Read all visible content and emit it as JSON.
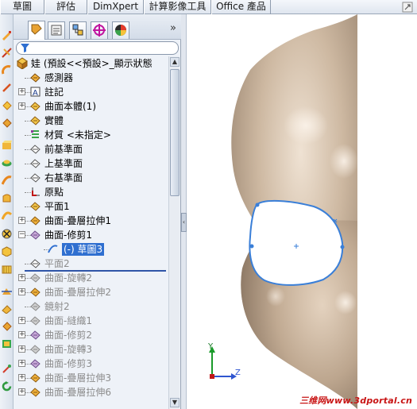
{
  "toptabs": [
    "草圖",
    "評估",
    "DimXpert",
    "計算影像工具",
    "Office 產品"
  ],
  "tree": {
    "root_label": "娃 (預設<<預設>_顯示狀態",
    "items": [
      {
        "label": "感測器",
        "icon": "sensor-icon",
        "expander": false,
        "grey": false
      },
      {
        "label": "註記",
        "icon": "annotation-icon",
        "expander": true,
        "grey": false
      },
      {
        "label": "曲面本體(1)",
        "icon": "surface-bodies-icon",
        "expander": true,
        "grey": false
      },
      {
        "label": "實體",
        "icon": "solid-bodies-icon",
        "expander": false,
        "grey": false
      },
      {
        "label": "材質 <未指定>",
        "icon": "material-icon",
        "expander": false,
        "grey": false
      },
      {
        "label": "前基準面",
        "icon": "plane-icon",
        "expander": false,
        "grey": false
      },
      {
        "label": "上基準面",
        "icon": "plane-icon",
        "expander": false,
        "grey": false
      },
      {
        "label": "右基準面",
        "icon": "plane-icon",
        "expander": false,
        "grey": false
      },
      {
        "label": "原點",
        "icon": "origin-icon",
        "expander": false,
        "grey": false
      },
      {
        "label": "平面1",
        "icon": "plane1-icon",
        "expander": false,
        "grey": false
      },
      {
        "label": "曲面-疊層拉伸1",
        "icon": "surface-loft-icon",
        "expander": true,
        "grey": false
      },
      {
        "label": "曲面-修剪1",
        "icon": "surface-trim-icon",
        "expander": "open",
        "grey": false
      },
      {
        "label": "(-) 草圖3",
        "icon": "sketch-icon",
        "expander": false,
        "grey": false,
        "child": true,
        "selected": true
      },
      {
        "label": "平面2",
        "icon": "plane-icon",
        "expander": false,
        "grey": true
      },
      {
        "label": "曲面-旋轉2",
        "icon": "surface-revolve-icon",
        "expander": true,
        "grey": true
      },
      {
        "label": "曲面-疊層拉伸2",
        "icon": "surface-loft-icon",
        "expander": true,
        "grey": true
      },
      {
        "label": "鏡射2",
        "icon": "mirror-icon",
        "expander": false,
        "grey": true
      },
      {
        "label": "曲面-縫織1",
        "icon": "surface-knit-icon",
        "expander": true,
        "grey": true
      },
      {
        "label": "曲面-修剪2",
        "icon": "surface-trim-icon",
        "expander": true,
        "grey": true
      },
      {
        "label": "曲面-旋轉3",
        "icon": "surface-revolve-icon",
        "expander": true,
        "grey": true
      },
      {
        "label": "曲面-修剪3",
        "icon": "surface-trim-icon",
        "expander": true,
        "grey": true
      },
      {
        "label": "曲面-疊層拉伸3",
        "icon": "surface-loft-icon",
        "expander": true,
        "grey": true
      },
      {
        "label": "曲面-疊層拉伸6",
        "icon": "surface-loft-icon",
        "expander": true,
        "grey": true
      }
    ]
  },
  "viewport": {
    "triad": {
      "y": "Y",
      "z": "Z"
    },
    "model_color": "#c9b6a0",
    "sketch_color": "#3a7fd8",
    "watermark": "三维网www.3dportal.cn"
  }
}
